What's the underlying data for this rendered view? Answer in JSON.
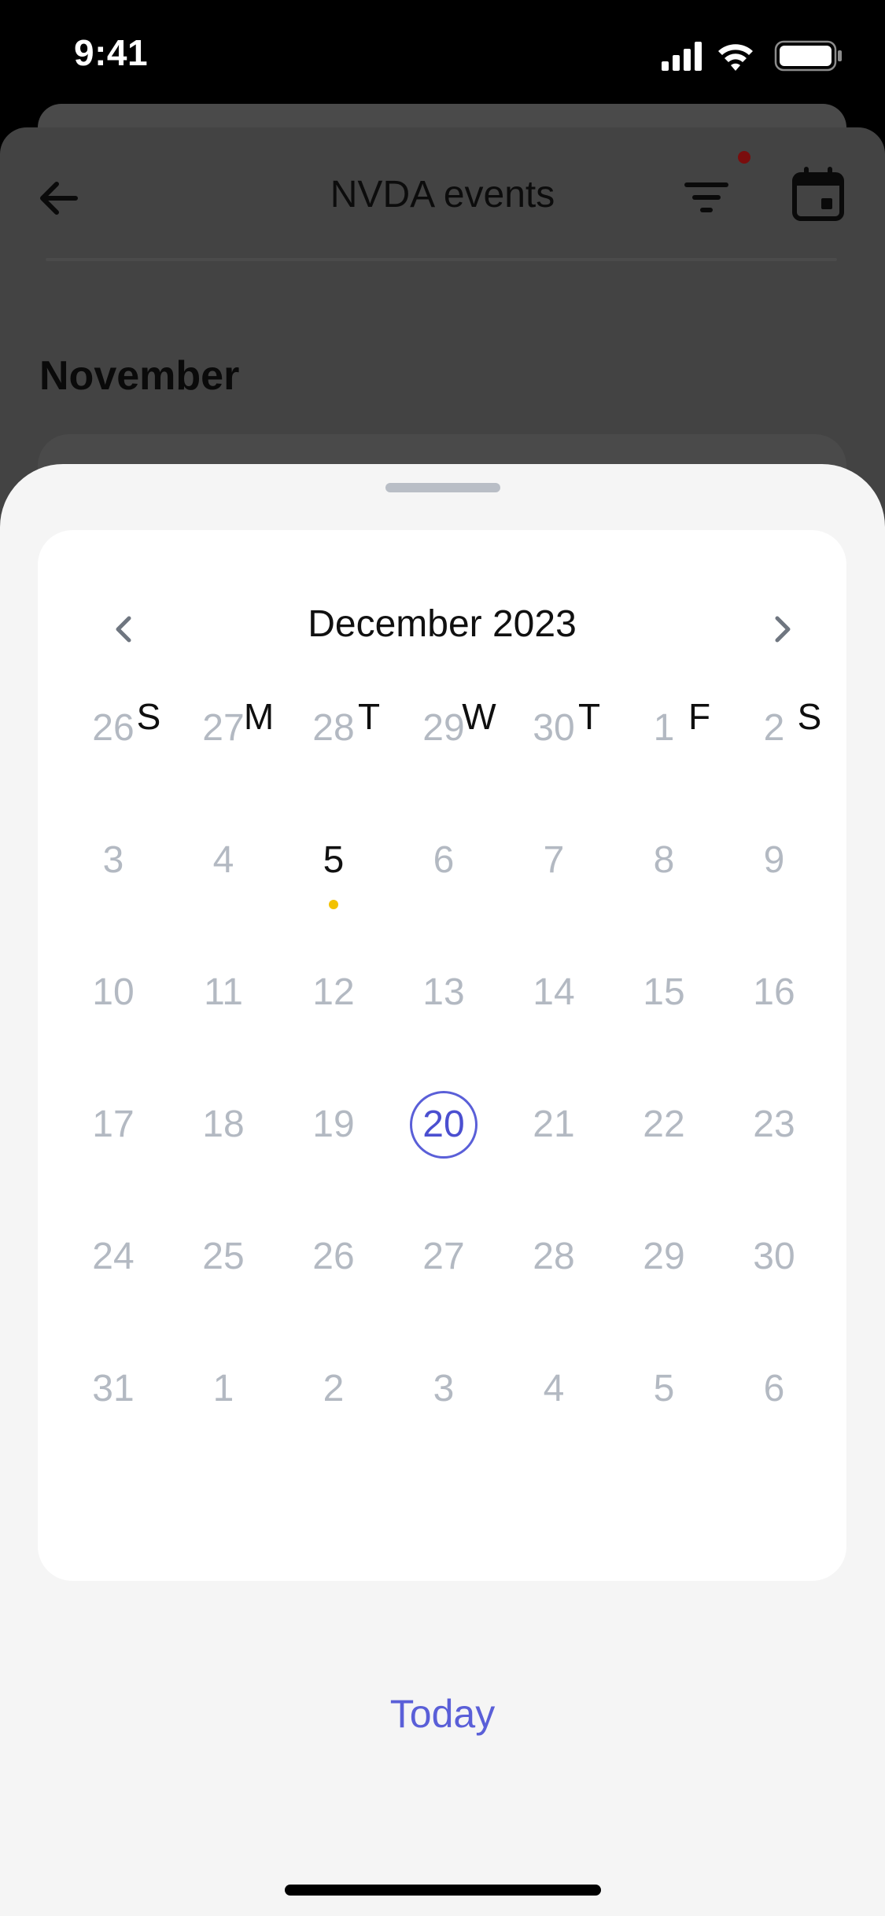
{
  "status_bar": {
    "time": "9:41"
  },
  "background_page": {
    "title": "NVDA events",
    "section_month": "November",
    "filter_badge_color": "#7a0d0d"
  },
  "calendar": {
    "month_title": "December 2023",
    "weekdays": [
      "S",
      "M",
      "T",
      "W",
      "T",
      "F",
      "S"
    ],
    "weeks": [
      [
        "26",
        "27",
        "28",
        "29",
        "30",
        "1",
        "2"
      ],
      [
        "3",
        "4",
        "5",
        "6",
        "7",
        "8",
        "9"
      ],
      [
        "10",
        "11",
        "12",
        "13",
        "14",
        "15",
        "16"
      ],
      [
        "17",
        "18",
        "19",
        "20",
        "21",
        "22",
        "23"
      ],
      [
        "24",
        "25",
        "26",
        "27",
        "28",
        "29",
        "30"
      ],
      [
        "31",
        "1",
        "2",
        "3",
        "4",
        "5",
        "6"
      ]
    ],
    "event_days": [
      "5"
    ],
    "selected_day": "20",
    "event_dot_color": "#f2c200",
    "accent_color": "#5a5fd8"
  },
  "actions": {
    "today_label": "Today"
  }
}
